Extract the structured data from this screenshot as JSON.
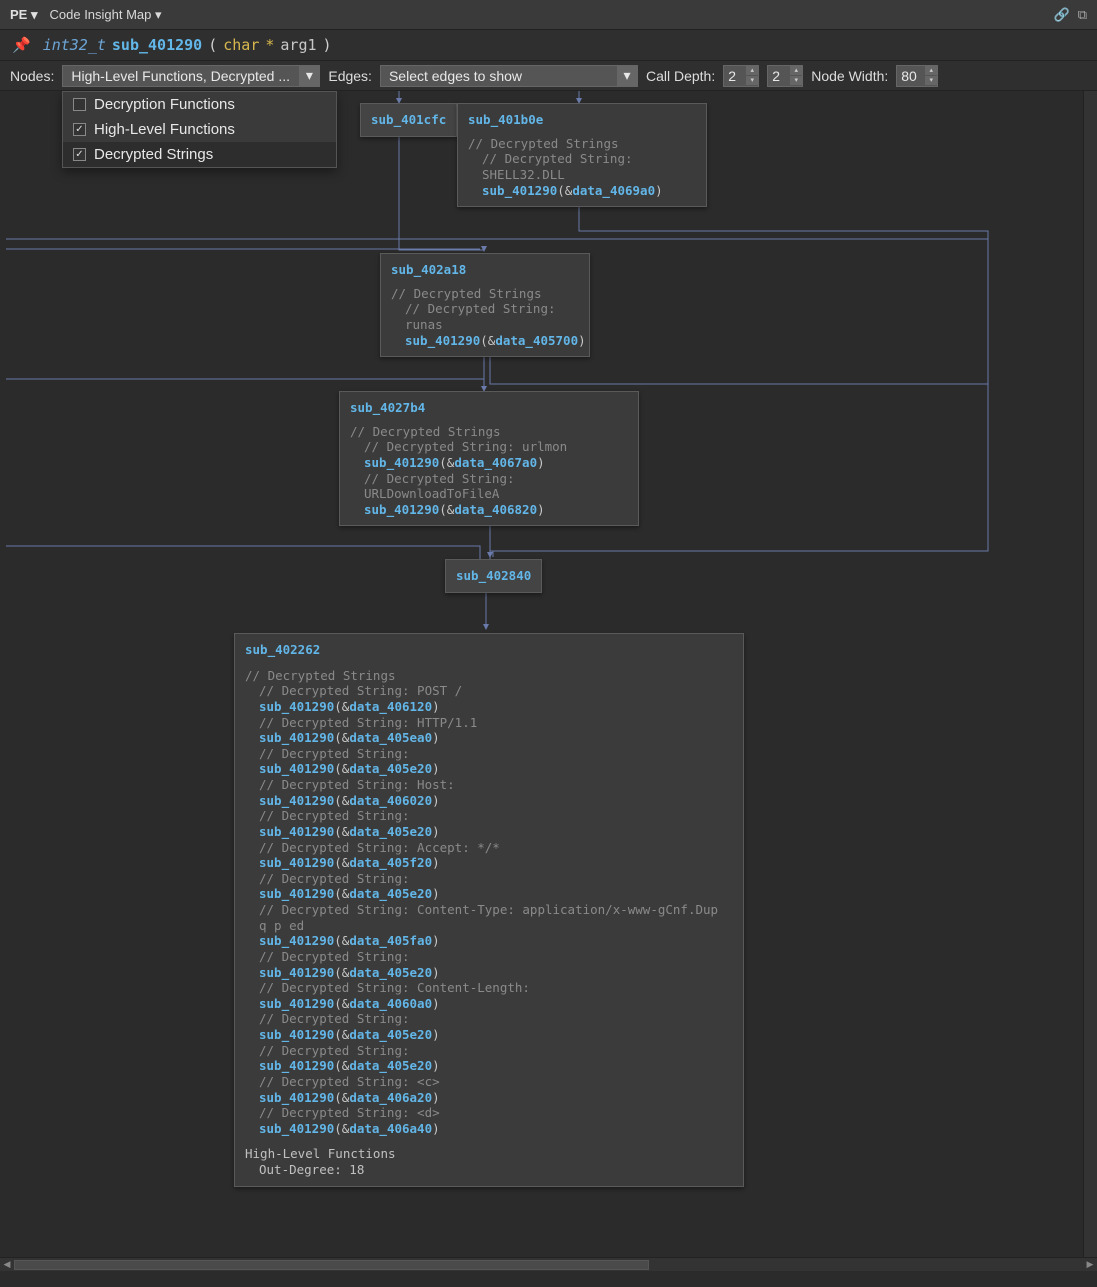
{
  "titlebar": {
    "pe": "PE",
    "tab": "Code Insight Map"
  },
  "function_signature": {
    "ret": "int32_t",
    "name": "sub_401290",
    "param_type": "char",
    "param_ptr": "*",
    "param_name": "arg1"
  },
  "toolbar": {
    "nodes_label": "Nodes:",
    "nodes_value": "High-Level Functions, Decrypted ...",
    "edges_label": "Edges:",
    "edges_value": "Select edges to show",
    "calldepth_label": "Call Depth:",
    "calldepth_a": "2",
    "calldepth_b": "2",
    "nodewidth_label": "Node Width:",
    "nodewidth_value": "80"
  },
  "dropdown": {
    "items": [
      {
        "label": "Decryption Functions",
        "checked": false
      },
      {
        "label": "High-Level Functions",
        "checked": true
      },
      {
        "label": "Decrypted Strings",
        "checked": true
      }
    ]
  },
  "nodes": {
    "n401cfc": {
      "title": "sub_401cfc"
    },
    "n401b0e": {
      "title": "sub_401b0e",
      "header": "// Decrypted Strings",
      "lines": [
        {
          "cmt": "// Decrypted String: SHELL32.DLL"
        },
        {
          "fn": "sub_401290",
          "data": "data_4069a0"
        }
      ]
    },
    "n402a18": {
      "title": "sub_402a18",
      "header": "// Decrypted Strings",
      "lines": [
        {
          "cmt": "// Decrypted String: runas"
        },
        {
          "fn": "sub_401290",
          "data": "data_405700"
        }
      ]
    },
    "n4027b4": {
      "title": "sub_4027b4",
      "header": "// Decrypted Strings",
      "lines": [
        {
          "cmt": "// Decrypted String: urlmon"
        },
        {
          "fn": "sub_401290",
          "data": "data_4067a0"
        },
        {
          "cmt": "// Decrypted String: URLDownloadToFileA"
        },
        {
          "fn": "sub_401290",
          "data": "data_406820"
        }
      ]
    },
    "n402840": {
      "title": "sub_402840"
    },
    "n402262": {
      "title": "sub_402262",
      "header": "// Decrypted Strings",
      "lines": [
        {
          "cmt": "// Decrypted String: POST /"
        },
        {
          "fn": "sub_401290",
          "data": "data_406120"
        },
        {
          "cmt": "// Decrypted String:  HTTP/1.1"
        },
        {
          "fn": "sub_401290",
          "data": "data_405ea0"
        },
        {
          "cmt": "// Decrypted String:"
        },
        {
          "fn": "sub_401290",
          "data": "data_405e20"
        },
        {
          "cmt": "// Decrypted String: Host:"
        },
        {
          "fn": "sub_401290",
          "data": "data_406020"
        },
        {
          "cmt": "// Decrypted String:"
        },
        {
          "fn": "sub_401290",
          "data": "data_405e20"
        },
        {
          "cmt": "// Decrypted String: Accept: */*"
        },
        {
          "fn": "sub_401290",
          "data": "data_405f20"
        },
        {
          "cmt": "// Decrypted String:"
        },
        {
          "fn": "sub_401290",
          "data": "data_405e20"
        },
        {
          "cmt": "// Decrypted String: Content-Type: application/x-www-gCnf.Dup q p ed"
        },
        {
          "fn": "sub_401290",
          "data": "data_405fa0"
        },
        {
          "cmt": "// Decrypted String:"
        },
        {
          "fn": "sub_401290",
          "data": "data_405e20"
        },
        {
          "cmt": "// Decrypted String: Content-Length:"
        },
        {
          "fn": "sub_401290",
          "data": "data_4060a0"
        },
        {
          "cmt": "// Decrypted String:"
        },
        {
          "fn": "sub_401290",
          "data": "data_405e20"
        },
        {
          "cmt": "// Decrypted String:"
        },
        {
          "fn": "sub_401290",
          "data": "data_405e20"
        },
        {
          "cmt": "// Decrypted String: <c>"
        },
        {
          "fn": "sub_401290",
          "data": "data_406a20"
        },
        {
          "cmt": "// Decrypted String: <d>"
        },
        {
          "fn": "sub_401290",
          "data": "data_406a40"
        }
      ],
      "footer1": "High-Level Functions",
      "footer2": "Out-Degree: 18"
    }
  }
}
